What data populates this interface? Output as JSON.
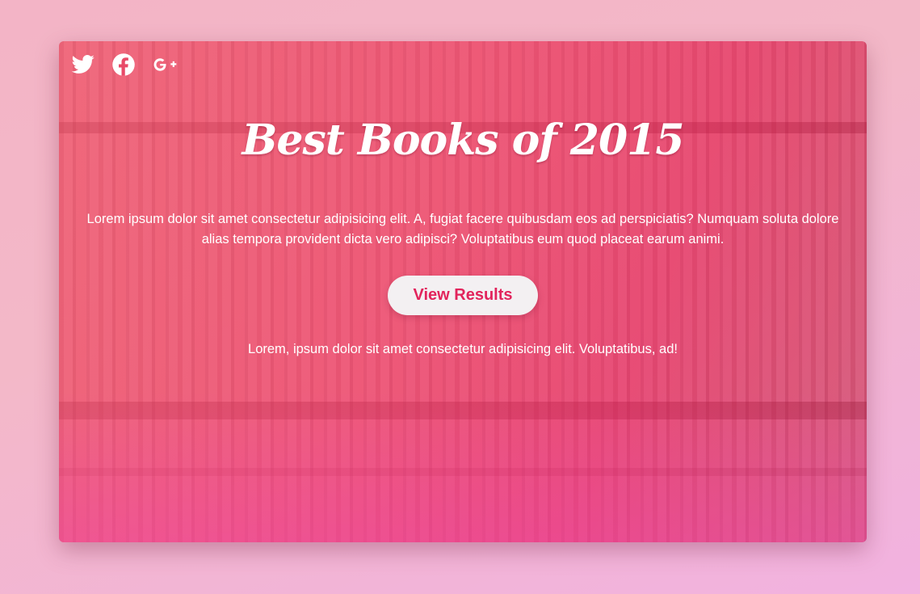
{
  "social": {
    "icons": [
      "twitter-icon",
      "facebook-icon",
      "google-plus-icon"
    ],
    "gplus_label": "G+"
  },
  "hero": {
    "title": "Best Books of 2015",
    "description": "Lorem ipsum dolor sit amet consectetur adipisicing elit. A, fugiat facere quibusdam eos ad perspiciatis? Numquam soluta dolore alias tempora provident dicta vero adipisci? Voluptatibus eum quod placeat earum animi.",
    "button_label": "View Results",
    "note": "Lorem, ipsum dolor sit amet consectetur adipisicing elit. Voluptatibus, ad!"
  },
  "colors": {
    "accent": "#e2245c",
    "button_bg": "#f3f0f2",
    "overlay": "#eb3458",
    "page_bg": "#f3b4c6"
  }
}
